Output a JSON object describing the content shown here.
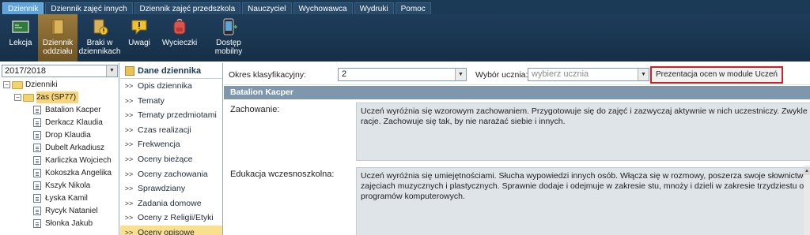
{
  "menu": {
    "tabs": [
      {
        "label": "Dziennik",
        "active": true
      },
      {
        "label": "Dziennik zajęć innych"
      },
      {
        "label": "Dziennik zajęć przedszkola"
      },
      {
        "label": "Nauczyciel"
      },
      {
        "label": "Wychowawca"
      },
      {
        "label": "Wydruki"
      },
      {
        "label": "Pomoc"
      }
    ]
  },
  "toolbar": {
    "lekcja": "Lekcja",
    "oddzial_1": "Dziennik",
    "oddzial_2": "oddziału",
    "braki_1": "Braki w",
    "braki_2": "dziennikach",
    "uwagi": "Uwagi",
    "wycieczki": "Wycieczki",
    "dostep_1": "Dostęp",
    "dostep_2": "mobilny"
  },
  "left": {
    "year": "2017/2018",
    "root": "Dzienniki",
    "class_name": "2as (SP77)",
    "students": [
      "Batalion Kacper",
      "Derkacz Klaudia",
      "Drop Klaudia",
      "Dubelt Arkadiusz",
      "Karliczka Wojciech",
      "Kokoszka Angelika",
      "Kszyk Nikola",
      "Łyska Kamil",
      "Rycyk Nataniel",
      "Słonka Jakub"
    ]
  },
  "middle": {
    "header": "Dane dziennika",
    "items": [
      "Opis dziennika",
      "Tematy",
      "Tematy przedmiotami",
      "Czas realizacji",
      "Frekwencja",
      "Oceny bieżące",
      "Oceny zachowania",
      "Sprawdziany",
      "Zadania domowe",
      "Oceny z Religii/Etyki",
      "Oceny opisowe"
    ],
    "chevron": ">>"
  },
  "content": {
    "okres_label": "Okres klasyfikacyjny:",
    "okres_value": "2",
    "uczen_label": "Wybór ucznia:",
    "uczen_placeholder": "wybierz ucznia",
    "prezentacja_button": "Prezentacja ocen w module Uczeń",
    "student_name": "Batalion Kacper",
    "zachowanie_label": "Zachowanie:",
    "zachowanie_line1": "Uczeń wyróżnia się wzorowym zachowaniem. Przygotowuje się do zajęć i zazwyczaj aktywnie w nich uczestniczy. Zwykle pracuje samo",
    "zachowanie_line2": "racje. Zachowuje się tak, by nie narażać siebie i innych.",
    "edukacja_label": "Edukacja wczesnoszkolna:",
    "edukacja_line1": "Uczeń wyróżnia się umiejętnościami. Słucha wypowiedzi innych osób. Włącza się w rozmowy, poszerza swoje słownictwo. Układa i zap",
    "edukacja_line2": "zajęciach muzycznych i plastycznych. Sprawnie dodaje i odejmuje w zakresie stu, mnoży i dzieli w zakresie trzydziestu oraz wykonuje c",
    "edukacja_line3": "programów komputerowych."
  }
}
